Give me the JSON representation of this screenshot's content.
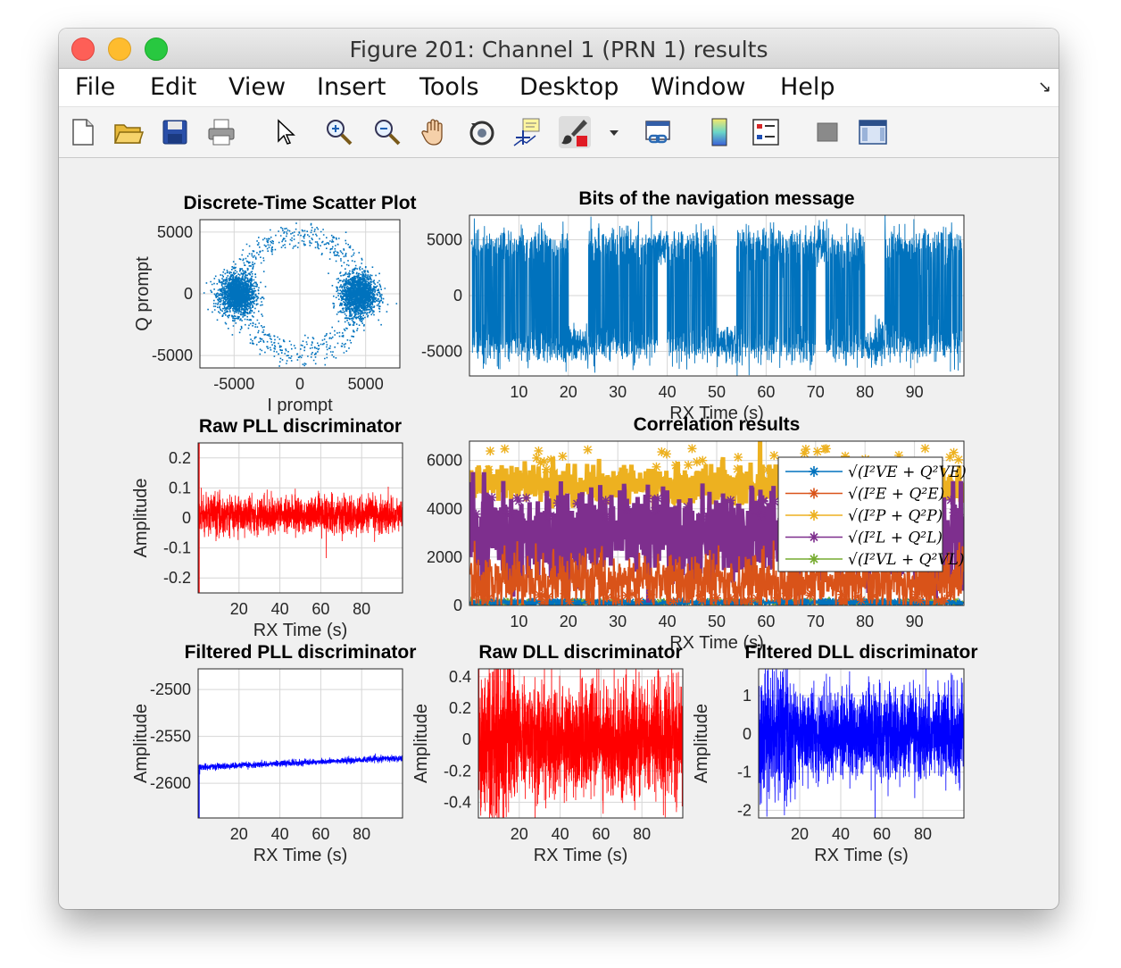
{
  "window": {
    "title": "Figure 201: Channel 1 (PRN 1) results"
  },
  "menu": [
    "File",
    "Edit",
    "View",
    "Insert",
    "Tools",
    "Desktop",
    "Window",
    "Help"
  ],
  "toolbar_icons": [
    "new-figure-icon",
    "open-file-icon",
    "save-icon",
    "print-icon",
    "pointer-icon",
    "zoom-in-icon",
    "zoom-out-icon",
    "pan-hand-icon",
    "rotate-3d-icon",
    "data-cursor-icon",
    "brush-icon",
    "brush-dropdown-icon",
    "link-plot-icon",
    "colorbar-icon",
    "legend-icon",
    "hide-plot-tools-icon",
    "show-plot-tools-icon"
  ],
  "colors": {
    "blue": "#0072BD",
    "orange": "#D95319",
    "yellow": "#EDB120",
    "purple": "#7E2F8E",
    "green": "#77AC30",
    "red": "#FF0000",
    "pure_blue": "#0000FF"
  },
  "chart_data": [
    {
      "id": "scatter",
      "type": "scatter",
      "title": "Discrete-Time Scatter Plot",
      "xlabel": "I prompt",
      "ylabel": "Q prompt",
      "xlim": [
        -7600,
        7600
      ],
      "ylim": [
        -6000,
        6000
      ],
      "xticks": [
        -5000,
        0,
        5000
      ],
      "yticks": [
        -5000,
        0,
        5000
      ],
      "grid": true,
      "series": [
        {
          "color": "blue",
          "clusters": [
            {
              "cx": -4800,
              "cy": 0,
              "sx": 900,
              "sy": 900
            },
            {
              "cx": 4400,
              "cy": 0,
              "sx": 900,
              "sy": 900
            }
          ],
          "ring_radius": 4800
        }
      ]
    },
    {
      "id": "navbits",
      "type": "line",
      "title": "Bits of the navigation message",
      "xlabel": "RX Time (s)",
      "ylabel": "",
      "xlim": [
        0,
        100
      ],
      "ylim": [
        -7200,
        7200
      ],
      "xticks": [
        10,
        20,
        30,
        40,
        50,
        60,
        70,
        80,
        90
      ],
      "yticks": [
        -5000,
        0,
        5000
      ],
      "grid": true,
      "series": [
        {
          "color": "blue",
          "levels": [
            4400,
            -4400
          ],
          "gaps_positive": [
            [
              20,
              24
            ],
            [
              50,
              54
            ],
            [
              80,
              84
            ]
          ],
          "gaps_negative": [
            [
              38,
              40
            ],
            [
              70,
              72
            ]
          ]
        }
      ]
    },
    {
      "id": "rawpll",
      "type": "line",
      "title": "Raw PLL discriminator",
      "xlabel": "RX Time (s)",
      "ylabel": "Amplitude",
      "xlim": [
        0,
        100
      ],
      "ylim": [
        -0.25,
        0.25
      ],
      "xticks": [
        20,
        40,
        60,
        80
      ],
      "yticks": [
        0.2,
        0.1,
        0,
        -0.1,
        -0.2
      ],
      "grid": true,
      "series": [
        {
          "color": "red",
          "center": 0.01,
          "amplitude": 0.03,
          "spike_at_start": [
            -0.25,
            0.25
          ]
        }
      ]
    },
    {
      "id": "corr",
      "type": "line",
      "title": "Correlation results",
      "xlabel": "RX Time (s)",
      "ylabel": "",
      "xlim": [
        0,
        100
      ],
      "ylim": [
        0,
        6800
      ],
      "xticks": [
        10,
        20,
        30,
        40,
        50,
        60,
        70,
        80,
        90
      ],
      "yticks": [
        0,
        2000,
        4000,
        6000
      ],
      "grid": true,
      "legend_position": "top-right",
      "series": [
        {
          "name": "√(I²VE + Q²VE)",
          "color": "blue",
          "level": 120
        },
        {
          "name": "√(I²E + Q²E)",
          "color": "orange",
          "level": 1000
        },
        {
          "name": "√(I²P + Q²P)",
          "color": "yellow",
          "level": 5000
        },
        {
          "name": "√(I²L + Q²L)",
          "color": "purple",
          "level": 2900
        },
        {
          "name": "√(I²VL + Q²VL)",
          "color": "green",
          "level": 120
        }
      ]
    },
    {
      "id": "filtpll",
      "type": "line",
      "title": "Filtered PLL discriminator",
      "xlabel": "RX Time (s)",
      "ylabel": "Amplitude",
      "xlim": [
        0,
        100
      ],
      "ylim": [
        -2637,
        -2478
      ],
      "xticks": [
        20,
        40,
        60,
        80
      ],
      "yticks": [
        -2500,
        -2550,
        -2600
      ],
      "grid": true,
      "series": [
        {
          "color": "pure_blue",
          "start": -2583,
          "end": -2573
        }
      ]
    },
    {
      "id": "rawdll",
      "type": "line",
      "title": "Raw DLL discriminator",
      "xlabel": "RX Time (s)",
      "ylabel": "Amplitude",
      "xlim": [
        0,
        100
      ],
      "ylim": [
        -0.5,
        0.45
      ],
      "xticks": [
        20,
        40,
        60,
        80
      ],
      "yticks": [
        0.4,
        0.2,
        0,
        -0.2,
        -0.4
      ],
      "grid": true,
      "series": [
        {
          "color": "red",
          "center": 0.0,
          "amplitude": 0.2
        }
      ]
    },
    {
      "id": "filtdll",
      "type": "line",
      "title": "Filtered DLL discriminator",
      "xlabel": "RX Time (s)",
      "ylabel": "Amplitude",
      "xlim": [
        0,
        100
      ],
      "ylim": [
        -2.2,
        1.7
      ],
      "xticks": [
        20,
        40,
        60,
        80
      ],
      "yticks": [
        1,
        0,
        -1,
        -2
      ],
      "grid": true,
      "series": [
        {
          "color": "pure_blue",
          "center": 0.0,
          "amplitude": 0.7
        }
      ]
    }
  ]
}
